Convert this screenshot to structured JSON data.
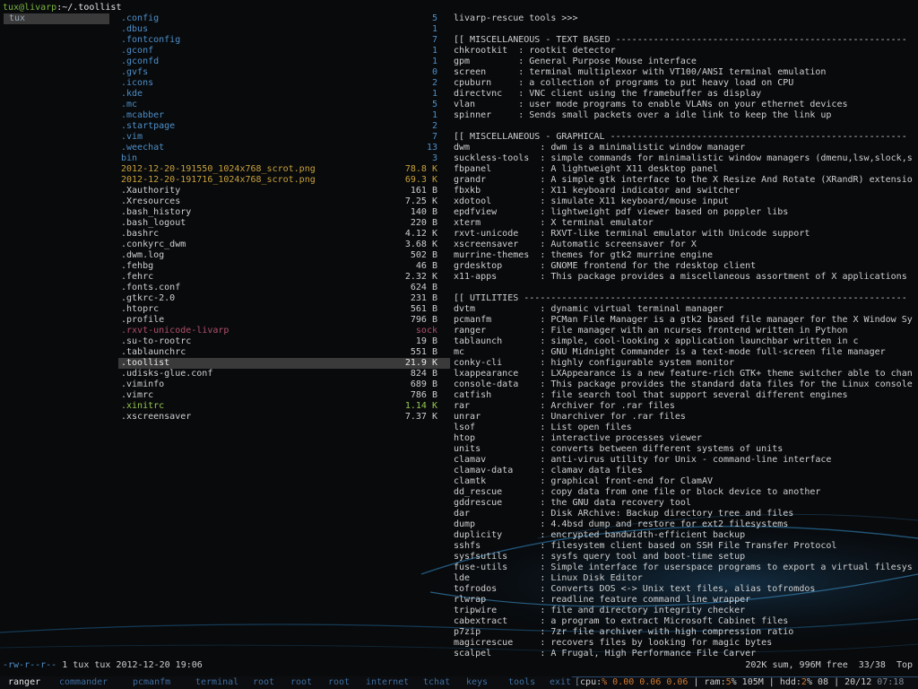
{
  "path": {
    "user_host": "tux@livarp",
    "path_sep": ":",
    "path": "~/.toollist"
  },
  "parent_column": {
    "items": [
      "tux"
    ]
  },
  "files": [
    {
      "name": ".config",
      "size": "5",
      "color": "blue"
    },
    {
      "name": ".dbus",
      "size": "1",
      "color": "blue"
    },
    {
      "name": ".fontconfig",
      "size": "7",
      "color": "blue"
    },
    {
      "name": ".gconf",
      "size": "1",
      "color": "blue"
    },
    {
      "name": ".gconfd",
      "size": "1",
      "color": "blue"
    },
    {
      "name": ".gvfs",
      "size": "0",
      "color": "blue"
    },
    {
      "name": ".icons",
      "size": "2",
      "color": "blue"
    },
    {
      "name": ".kde",
      "size": "1",
      "color": "blue"
    },
    {
      "name": ".mc",
      "size": "5",
      "color": "blue"
    },
    {
      "name": ".mcabber",
      "size": "1",
      "color": "blue"
    },
    {
      "name": ".startpage",
      "size": "2",
      "color": "blue"
    },
    {
      "name": ".vim",
      "size": "7",
      "color": "blue"
    },
    {
      "name": ".weechat",
      "size": "13",
      "color": "blue"
    },
    {
      "name": "bin",
      "size": "3",
      "color": "blue"
    },
    {
      "name": "2012-12-20-191550_1024x768_scrot.png",
      "size": "78.8 K",
      "color": "orange"
    },
    {
      "name": "2012-12-20-191716_1024x768_scrot.png",
      "size": "69.3 K",
      "color": "orange"
    },
    {
      "name": ".Xauthority",
      "size": "161 B",
      "color": "grey"
    },
    {
      "name": ".Xresources",
      "size": "7.25 K",
      "color": "grey"
    },
    {
      "name": ".bash_history",
      "size": "140 B",
      "color": "grey"
    },
    {
      "name": ".bash_logout",
      "size": "220 B",
      "color": "grey"
    },
    {
      "name": ".bashrc",
      "size": "4.12 K",
      "color": "grey"
    },
    {
      "name": ".conkyrc_dwm",
      "size": "3.68 K",
      "color": "grey"
    },
    {
      "name": ".dwm.log",
      "size": "502 B",
      "color": "grey"
    },
    {
      "name": ".fehbg",
      "size": "46 B",
      "color": "grey"
    },
    {
      "name": ".fehrc",
      "size": "2.32 K",
      "color": "grey"
    },
    {
      "name": ".fonts.conf",
      "size": "624 B",
      "color": "grey"
    },
    {
      "name": ".gtkrc-2.0",
      "size": "231 B",
      "color": "grey"
    },
    {
      "name": ".htoprc",
      "size": "561 B",
      "color": "grey"
    },
    {
      "name": ".profile",
      "size": "796 B",
      "color": "grey"
    },
    {
      "name": ".rxvt-unicode-livarp",
      "size": "sock",
      "color": "pink"
    },
    {
      "name": ".su-to-rootrc",
      "size": "19 B",
      "color": "grey"
    },
    {
      "name": ".tablaunchrc",
      "size": "551 B",
      "color": "grey"
    },
    {
      "name": ".toollist",
      "size": "21.9 K",
      "color": "grey",
      "selected": true
    },
    {
      "name": ".udisks-glue.conf",
      "size": "824 B",
      "color": "grey"
    },
    {
      "name": ".viminfo",
      "size": "689 B",
      "color": "grey"
    },
    {
      "name": ".vimrc",
      "size": "786 B",
      "color": "grey"
    },
    {
      "name": ".xinitrc",
      "size": "1.14 K",
      "color": "green"
    },
    {
      "name": ".xscreensaver",
      "size": "7.37 K",
      "color": "grey"
    }
  ],
  "preview_lines": [
    "livarp-rescue tools >>>",
    "",
    "[[ MISCELLANEOUS - TEXT BASED ------------------------------------------------------",
    "chkrootkit  : rootkit detector",
    "gpm         : General Purpose Mouse interface",
    "screen      : terminal multiplexor with VT100/ANSI terminal emulation",
    "cpuburn     : a collection of programs to put heavy load on CPU",
    "directvnc   : VNC client using the framebuffer as display",
    "vlan        : user mode programs to enable VLANs on your ethernet devices",
    "spinner     : Sends small packets over a idle link to keep the link up",
    "",
    "[[ MISCELLANEOUS - GRAPHICAL -------------------------------------------------------",
    "dwm             : dwm is a minimalistic window manager",
    "suckless-tools  : simple commands for minimalistic window managers (dmenu,lsw,slock,s",
    "fbpanel         : A lightweight X11 desktop panel",
    "grandr          : A simple gtk interface to the X Resize And Rotate (XRandR) extensio",
    "fbxkb           : X11 keyboard indicator and switcher",
    "xdotool         : simulate X11 keyboard/mouse input",
    "epdfview        : lightweight pdf viewer based on poppler libs",
    "xterm           : X terminal emulator",
    "rxvt-unicode    : RXVT-like terminal emulator with Unicode support",
    "xscreensaver    : Automatic screensaver for X",
    "murrine-themes  : themes for gtk2 murrine engine",
    "grdesktop       : GNOME frontend for the rdesktop client",
    "x11-apps        : This package provides a miscellaneous assortment of X applications",
    "",
    "[[ UTILITIES -----------------------------------------------------------------------",
    "dvtm            : dynamic virtual terminal manager",
    "pcmanfm         : PCMan File Manager is a gtk2 based file manager for the X Window Sy",
    "ranger          : File manager with an ncurses frontend written in Python",
    "tablaunch       : simple, cool-looking x application launchbar written in c",
    "mc              : GNU Midnight Commander is a text-mode full-screen file manager",
    "conky-cli       : highly configurable system monitor",
    "lxappearance    : LXAppearance is a new feature-rich GTK+ theme switcher able to chan",
    "console-data    : This package provides the standard data files for the Linux console",
    "catfish         : file search tool that support several different engines",
    "rar             : Archiver for .rar files",
    "unrar           : Unarchiver for .rar files",
    "lsof            : List open files",
    "htop            : interactive processes viewer",
    "units           : converts between different systems of units",
    "clamav          : anti-virus utility for Unix - command-line interface",
    "clamav-data     : clamav data files",
    "clamtk          : graphical front-end for ClamAV",
    "dd_rescue       : copy data from one file or block device to another",
    "gddrescue       : the GNU data recovery tool",
    "dar             : Disk ARchive: Backup directory tree and files",
    "dump            : 4.4bsd dump and restore for ext2 filesystems",
    "duplicity       : encrypted bandwidth-efficient backup",
    "sshfs           : filesystem client based on SSH File Transfer Protocol",
    "sysfsutils      : sysfs query tool and boot-time setup",
    "fuse-utils      : Simple interface for userspace programs to export a virtual filesys",
    "lde             : Linux Disk Editor",
    "tofrodos        : Converts DOS <-> Unix text files, alias tofromdos",
    "rlwrap          : readline feature command line wrapper",
    "tripwire        : file and directory integrity checker",
    "cabextract      : a program to extract Microsoft Cabinet files",
    "p7zip           : 7zr file archiver with high compression ratio",
    "magicrescue     : recovers files by looking for magic bytes",
    "scalpel         : A Frugal, High Performance File Carver"
  ],
  "status": {
    "perms": "-rw-r--r--",
    "info": "1 tux tux 2012-12-20 19:06",
    "summary": "202K sum, 996M free",
    "position": "33/38",
    "scroll": "Top"
  },
  "taskbar": {
    "tabs": [
      "ranger",
      "commander",
      "pcmanfm",
      "terminal",
      "root",
      "root",
      "root",
      "internet",
      "tchat",
      "keys",
      "tools",
      "exit"
    ],
    "active_tab": "ranger",
    "sys": {
      "bracket": "[",
      "cpu_label": "cpu",
      "cpu_pct": "% 0.00 0.06 0.06",
      "ram_label": "ram",
      "ram_value": "5",
      "ram_rest": "% 105M",
      "hdd_label": "hdd",
      "hdd_value": "2",
      "hdd_rest": "% 08",
      "date": "20/12",
      "time": "07:18"
    }
  },
  "colors": {
    "background": "#080a0c",
    "directory": "#4f8fc8",
    "image": "#c8a03c",
    "socket": "#b0506a",
    "executable": "#9ac850",
    "prompt": "#7fb542",
    "selection": "#3a3a3a",
    "taskbar_inactive": "#3f6ea0",
    "accent": "#d07a30"
  }
}
